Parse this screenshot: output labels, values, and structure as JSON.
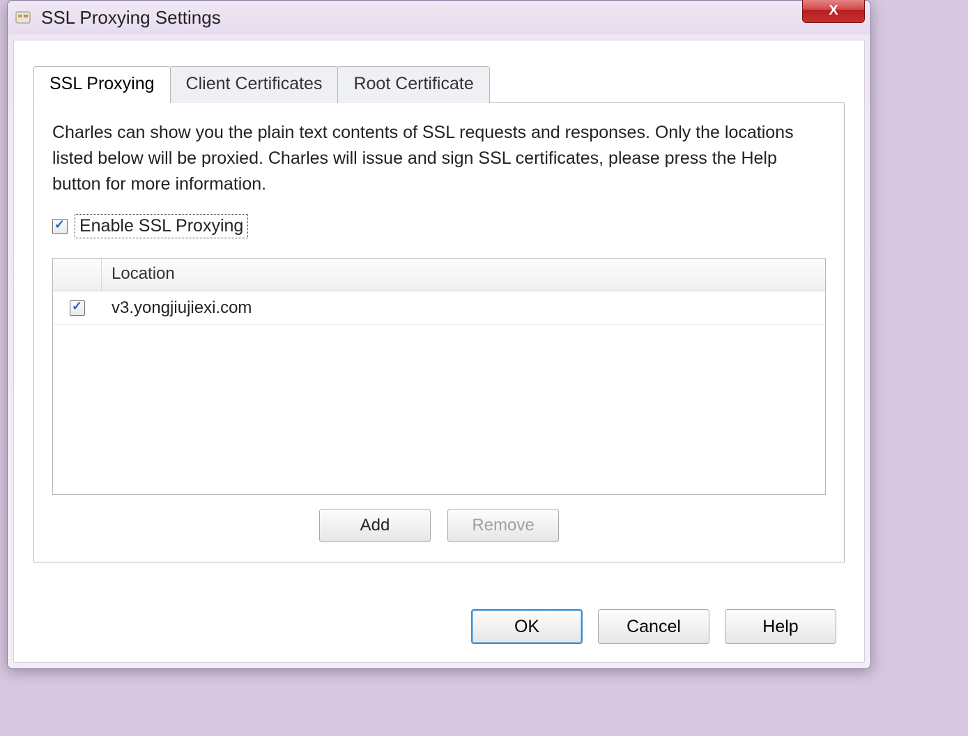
{
  "window": {
    "title": "SSL Proxying Settings",
    "close_label": "X"
  },
  "tabs": {
    "items": [
      {
        "label": "SSL Proxying",
        "active": true
      },
      {
        "label": "Client Certificates",
        "active": false
      },
      {
        "label": "Root Certificate",
        "active": false
      }
    ]
  },
  "panel": {
    "description": "Charles can show you the plain text contents of SSL requests and responses. Only the locations listed below will be proxied. Charles will issue and sign SSL certificates, please press the Help button for more information.",
    "enable_checkbox": {
      "checked": true,
      "label": "Enable SSL Proxying"
    },
    "table": {
      "header": {
        "location": "Location"
      },
      "rows": [
        {
          "checked": true,
          "location": "v3.yongjiujiexi.com"
        }
      ]
    },
    "buttons": {
      "add": "Add",
      "remove": "Remove",
      "remove_disabled": true
    }
  },
  "dialog_buttons": {
    "ok": "OK",
    "cancel": "Cancel",
    "help": "Help"
  }
}
